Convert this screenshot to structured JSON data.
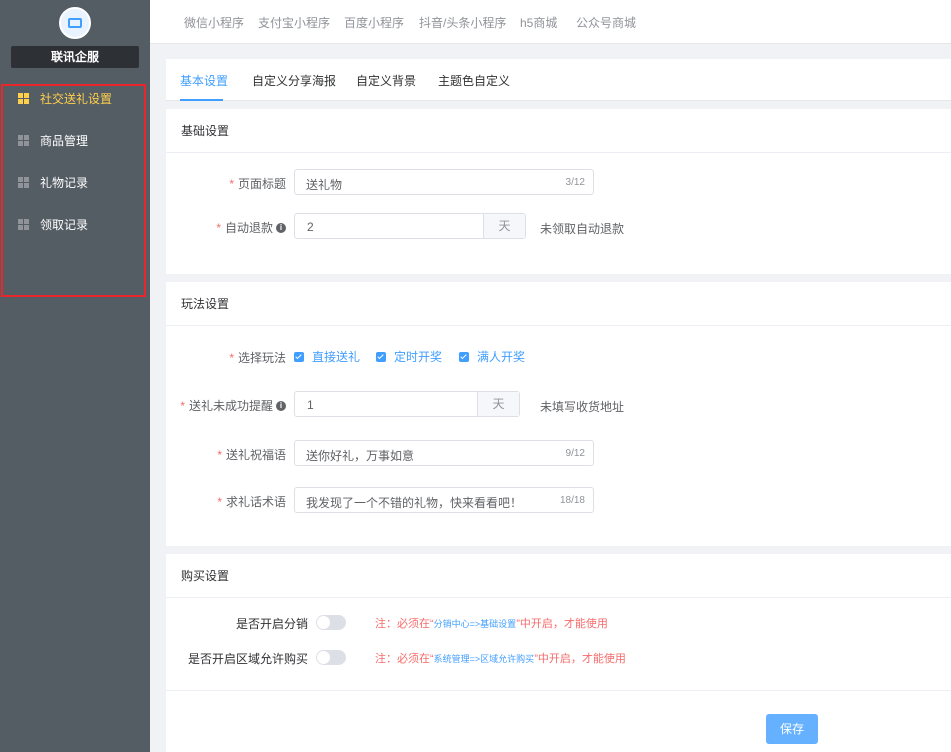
{
  "sidebar": {
    "brand": "联讯企服",
    "items": [
      {
        "label": "社交送礼设置",
        "active": true
      },
      {
        "label": "商品管理"
      },
      {
        "label": "礼物记录"
      },
      {
        "label": "领取记录"
      }
    ]
  },
  "topnav": [
    "微信小程序",
    "支付宝小程序",
    "百度小程序",
    "抖音/头条小程序",
    "h5商城",
    "公众号商城"
  ],
  "tabs": [
    "基本设置",
    "自定义分享海报",
    "自定义背景",
    "主题色自定义"
  ],
  "basic": {
    "header": "基础设置",
    "page_title": {
      "label": "页面标题",
      "value": "送礼物",
      "count": "3/12"
    },
    "auto_refund": {
      "label": "自动退款",
      "value": "2",
      "unit": "天",
      "hint": "未领取自动退款"
    }
  },
  "play": {
    "header": "玩法设置",
    "mode": {
      "label": "选择玩法",
      "options": [
        "直接送礼",
        "定时开奖",
        "满人开奖"
      ]
    },
    "remind": {
      "label": "送礼未成功提醒",
      "value": "1",
      "unit": "天",
      "hint": "未填写收货地址"
    },
    "blessing": {
      "label": "送礼祝福语",
      "value": "送你好礼，万事如意",
      "count": "9/12"
    },
    "pitch": {
      "label": "求礼话术语",
      "value": "我发现了一个不错的礼物，快来看看吧！",
      "count": "18/18"
    }
  },
  "buy": {
    "header": "购买设置",
    "distribution": {
      "label": "是否开启分销",
      "note_prefix": "注：必须在“",
      "note_link": "分销中心=>基础设置",
      "note_suffix": "”中开启，才能使用"
    },
    "region": {
      "label": "是否开启区域允许购买",
      "note_prefix": "注：必须在“",
      "note_link": "系统管理=>区域允许购买",
      "note_suffix": "”中开启，才能使用"
    }
  },
  "footer": {
    "save": "保存"
  },
  "colors": {
    "primary": "#409eff",
    "sidebar": "#545c64",
    "active": "#ffd04b",
    "danger": "#f56c6c"
  }
}
